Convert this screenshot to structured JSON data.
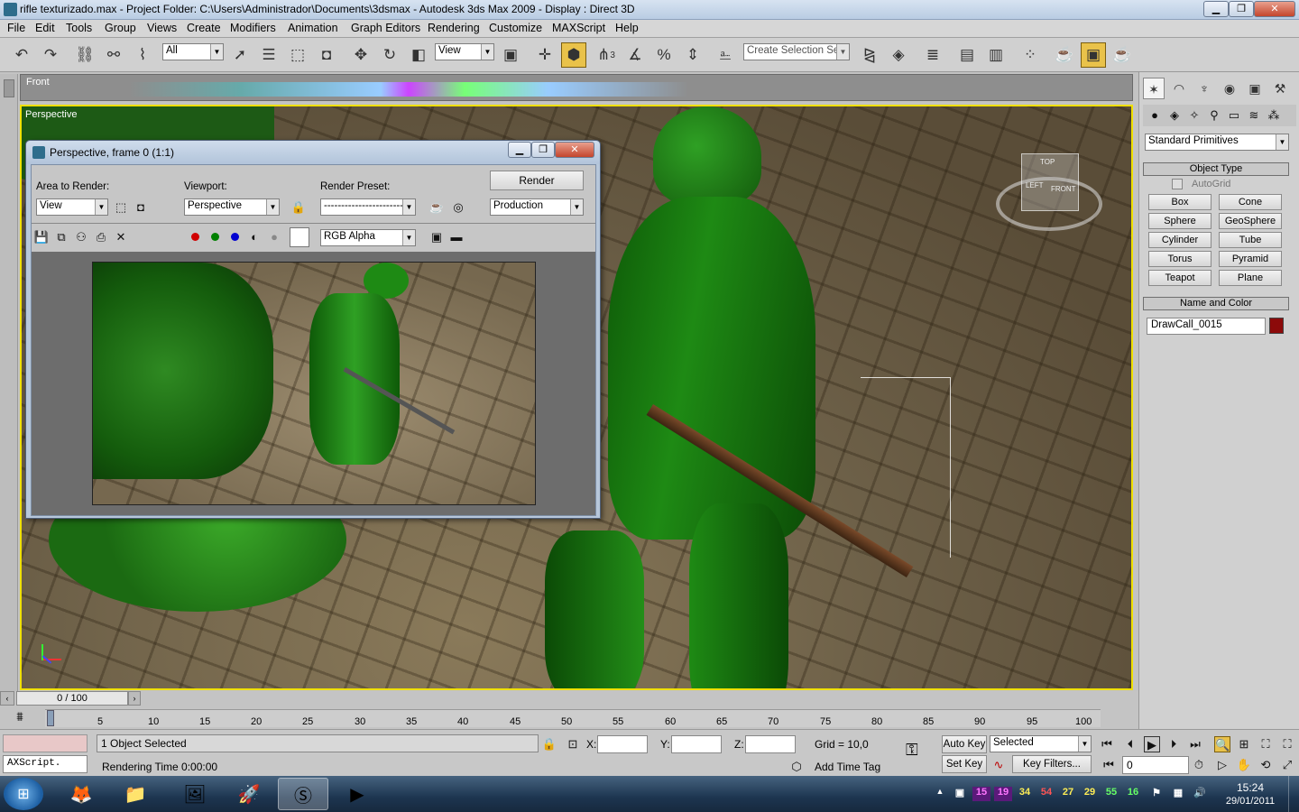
{
  "window": {
    "title": "rifle texturizado.max    - Project Folder: C:\\Users\\Administrador\\Documents\\3dsmax    - Autodesk 3ds Max  2009    - Display : Direct 3D",
    "min_label": "▁",
    "max_label": "❐",
    "close_label": "✕"
  },
  "menu": [
    "File",
    "Edit",
    "Tools",
    "Group",
    "Views",
    "Create",
    "Modifiers",
    "Animation",
    "Graph Editors",
    "Rendering",
    "Customize",
    "MAXScript",
    "Help"
  ],
  "toolbar": {
    "selection_filter": "All",
    "ref_coord": "View",
    "named_selection_placeholder": "Create Selection Set",
    "snap_label": "3",
    "icons": [
      "undo-icon",
      "redo-icon",
      "select-link-icon",
      "unlink-icon",
      "bind-spacewarp-icon",
      "select-object-icon",
      "select-by-name-icon",
      "rect-region-icon",
      "window-crossing-icon",
      "move-icon",
      "rotate-icon",
      "scale-icon",
      "pivot-icon",
      "manipulate-icon",
      "snap-toggle-icon",
      "angle-snap-icon",
      "percent-snap-icon",
      "spinner-snap-icon",
      "edit-named-sel-icon",
      "mirror-icon",
      "align-icon",
      "layer-manager-icon",
      "curve-editor-icon",
      "schematic-view-icon",
      "material-editor-icon",
      "render-setup-icon",
      "rendered-frame-icon",
      "render-production-icon"
    ]
  },
  "viewports": {
    "front_label": "Front",
    "perspective_label": "Perspective"
  },
  "render_window": {
    "title": "Perspective, frame 0 (1:1)",
    "area_label": "Area to Render:",
    "area_value": "View",
    "viewport_label": "Viewport:",
    "viewport_value": "Perspective",
    "preset_label": "Render Preset:",
    "preset_value": "----------------------------",
    "render_button": "Render",
    "production_value": "Production",
    "channel_value": "RGB Alpha",
    "colors": {
      "red": "#d00000",
      "green": "#008000",
      "blue": "#0000d0"
    }
  },
  "command_panel": {
    "category": "Standard Primitives",
    "object_type_title": "Object Type",
    "autogrid_label": "AutoGrid",
    "buttons": [
      "Box",
      "Cone",
      "Sphere",
      "GeoSphere",
      "Cylinder",
      "Tube",
      "Torus",
      "Pyramid",
      "Teapot",
      "Plane"
    ],
    "name_color_title": "Name and Color",
    "object_name": "DrawCall_0015",
    "object_color": "#8c0a0a",
    "viewcube": {
      "top": "TOP",
      "left": "LEFT",
      "front": "FRONT"
    }
  },
  "timeline": {
    "frame_counter": "0 / 100",
    "ticks": [
      "5",
      "10",
      "15",
      "20",
      "25",
      "30",
      "35",
      "40",
      "45",
      "50",
      "55",
      "60",
      "65",
      "70",
      "75",
      "80",
      "85",
      "90",
      "95",
      "100"
    ]
  },
  "status": {
    "maxscript": "AXScript.",
    "selected_info": "1 Object Selected",
    "prompt": "Rendering Time  0:00:00",
    "x_label": "X:",
    "y_label": "Y:",
    "z_label": "Z:",
    "grid": "Grid = 10,0",
    "add_time_tag": "Add Time Tag",
    "auto_key": "Auto Key",
    "set_key": "Set Key",
    "selected_dd": "Selected",
    "key_filters": "Key Filters...",
    "frame_value": "0"
  },
  "taskbar": {
    "tray_numbers": [
      "15",
      "19",
      "34",
      "54",
      "27",
      "29",
      "55",
      "16"
    ],
    "tray_colors": [
      "#ff77ff",
      "#ff77ff",
      "#ffee55",
      "#ff5555",
      "#ffee55",
      "#ffee55",
      "#66ff66",
      "#66ff66"
    ],
    "time": "15:24",
    "date": "29/01/2011"
  }
}
